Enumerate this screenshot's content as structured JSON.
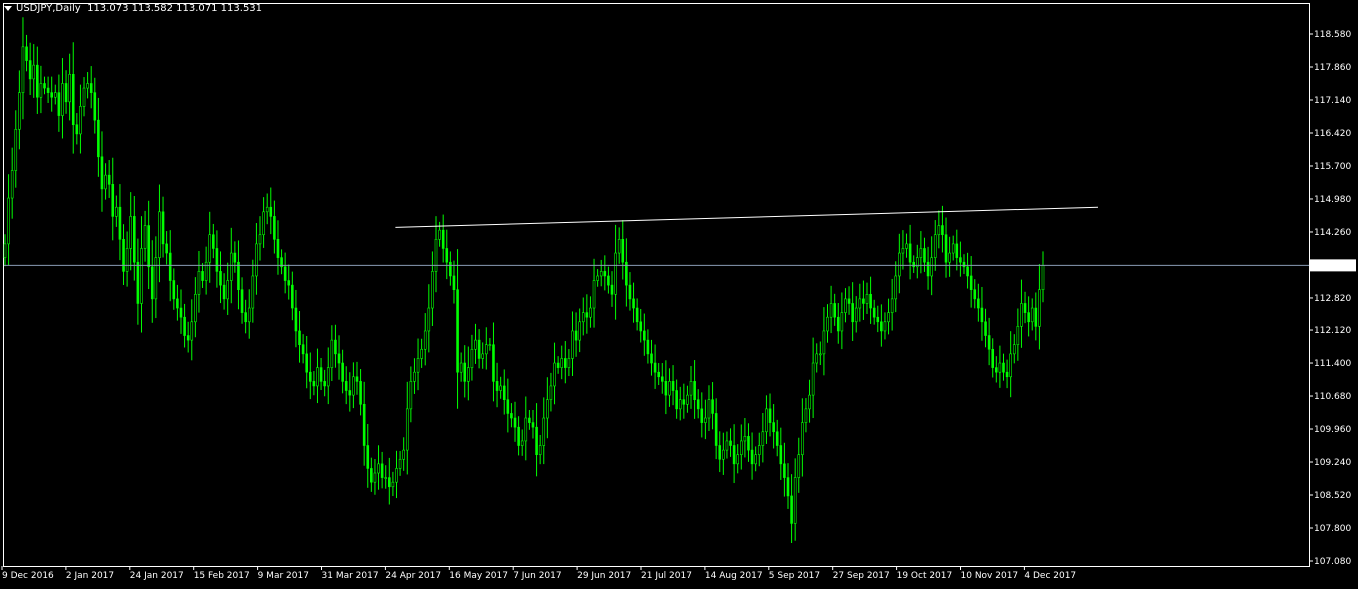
{
  "header": {
    "symbol": "USDJPY,Daily",
    "ohlc": "113.073 113.582 113.071 113.531"
  },
  "colors": {
    "background": "#000000",
    "frame": "#ffffff",
    "candle": "#00ff00",
    "trendline": "#ffffff",
    "price_line": "#8a9bb5",
    "price_label_bg": "#ffffff",
    "price_label_text": "#000000"
  },
  "chart_data": {
    "type": "bar",
    "series_style": "candlestick",
    "y_ticks": [
      "118.580",
      "117.860",
      "117.140",
      "116.420",
      "115.700",
      "114.980",
      "114.260",
      "113.531",
      "112.820",
      "112.120",
      "111.400",
      "110.680",
      "109.960",
      "109.240",
      "108.520",
      "107.800",
      "107.080"
    ],
    "ylim": [
      107.08,
      118.58
    ],
    "x_ticks": [
      "9 Dec 2016",
      "2 Jan 2017",
      "24 Jan 2017",
      "15 Feb 2017",
      "9 Mar 2017",
      "31 Mar 2017",
      "24 Apr 2017",
      "16 May 2017",
      "7 Jun 2017",
      "29 Jun 2017",
      "21 Jul 2017",
      "14 Aug 2017",
      "5 Sep 2017",
      "27 Sep 2017",
      "19 Oct 2017",
      "10 Nov 2017",
      "4 Dec 2017"
    ],
    "current_price": "113.531",
    "current_price_value": 113.531,
    "trendline": {
      "start": {
        "date": "24 Apr 2017",
        "price": 114.36
      },
      "end": {
        "date": "~22 Dec 2017",
        "price": 114.8
      }
    },
    "closes": [
      114.0,
      115.0,
      115.6,
      116.5,
      117.3,
      118.3,
      118.0,
      117.6,
      117.9,
      117.2,
      117.5,
      117.4,
      117.3,
      117.2,
      117.3,
      116.8,
      117.5,
      117.1,
      117.7,
      116.6,
      116.4,
      117.0,
      117.4,
      117.5,
      117.3,
      116.7,
      115.9,
      115.2,
      115.5,
      115.3,
      114.6,
      114.8,
      114.1,
      113.4,
      113.9,
      114.6,
      113.6,
      112.7,
      113.9,
      114.4,
      113.5,
      112.8,
      113.7,
      114.7,
      114.0,
      113.8,
      113.2,
      112.8,
      112.6,
      112.4,
      112.0,
      111.9,
      112.3,
      112.9,
      113.4,
      113.2,
      113.6,
      114.2,
      113.9,
      113.4,
      113.1,
      112.8,
      113.2,
      113.8,
      113.6,
      113.0,
      112.5,
      112.3,
      112.6,
      113.3,
      114.0,
      114.2,
      114.7,
      114.8,
      114.6,
      114.1,
      113.7,
      113.5,
      113.2,
      113.1,
      112.6,
      112.1,
      111.8,
      111.6,
      111.2,
      111.0,
      110.9,
      111.3,
      111.0,
      110.9,
      111.3,
      111.9,
      111.6,
      111.4,
      111.0,
      110.8,
      110.7,
      111.1,
      111.0,
      110.5,
      109.6,
      109.1,
      108.8,
      109.0,
      109.2,
      108.9,
      108.9,
      108.7,
      108.8,
      109.1,
      109.3,
      109.5,
      110.4,
      111.0,
      111.2,
      111.5,
      111.7,
      112.1,
      112.6,
      113.4,
      114.1,
      114.3,
      113.9,
      113.6,
      113.3,
      113.0,
      111.2,
      111.4,
      111.0,
      111.3,
      111.7,
      111.9,
      111.5,
      111.6,
      111.8,
      111.8,
      111.0,
      110.8,
      110.9,
      110.6,
      110.3,
      110.2,
      110.0,
      109.6,
      109.7,
      110.2,
      110.1,
      110.0,
      109.4,
      109.6,
      110.2,
      110.6,
      110.9,
      111.4,
      111.3,
      111.5,
      111.3,
      111.5,
      112.1,
      111.9,
      112.3,
      112.5,
      112.4,
      112.6,
      113.2,
      113.3,
      113.4,
      113.3,
      113.1,
      112.9,
      113.8,
      114.1,
      113.6,
      113.1,
      112.8,
      112.6,
      112.3,
      112.1,
      111.9,
      111.6,
      111.4,
      111.2,
      111.1,
      111.0,
      110.7,
      111.0,
      110.8,
      110.4,
      110.6,
      110.5,
      110.7,
      111.0,
      110.6,
      110.4,
      110.1,
      110.2,
      110.6,
      110.3,
      109.6,
      109.3,
      109.5,
      109.7,
      109.6,
      109.2,
      109.4,
      109.7,
      109.8,
      109.5,
      109.2,
      109.4,
      109.6,
      109.9,
      110.4,
      110.1,
      109.9,
      109.6,
      109.2,
      108.9,
      108.5,
      107.9,
      108.9,
      109.4,
      110.1,
      110.4,
      110.7,
      111.4,
      111.6,
      111.6,
      112.1,
      112.4,
      112.7,
      112.4,
      112.1,
      112.5,
      112.8,
      112.7,
      112.3,
      112.6,
      112.8,
      112.7,
      112.9,
      112.6,
      112.4,
      112.3,
      112.1,
      112.3,
      112.5,
      112.8,
      113.3,
      113.8,
      113.9,
      114.0,
      113.6,
      113.5,
      113.7,
      113.9,
      113.6,
      113.3,
      113.7,
      114.2,
      114.4,
      114.2,
      113.6,
      113.8,
      114.0,
      113.7,
      113.6,
      113.5,
      113.3,
      113.0,
      112.8,
      112.6,
      112.3,
      112.0,
      111.7,
      111.3,
      111.2,
      111.4,
      111.2,
      111.1,
      111.6,
      111.8,
      112.2,
      112.7,
      112.5,
      112.3,
      112.6,
      112.2,
      113.0,
      113.531
    ]
  }
}
